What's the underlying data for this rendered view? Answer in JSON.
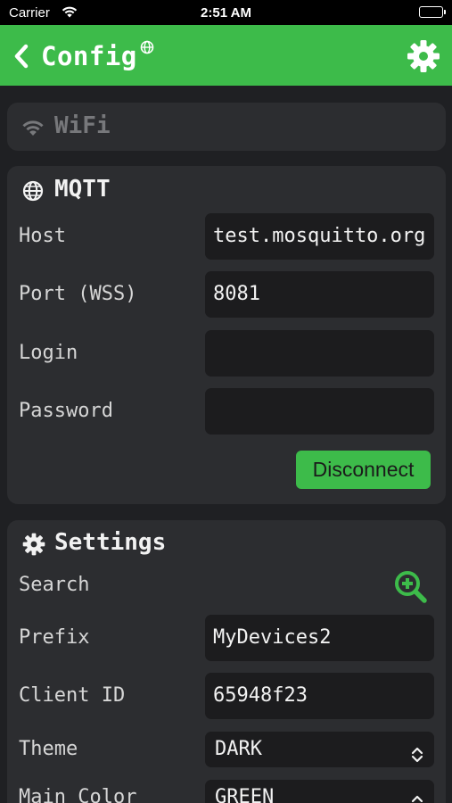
{
  "status_bar": {
    "carrier": "Carrier",
    "time": "2:51 AM"
  },
  "header": {
    "title": "Config"
  },
  "wifi": {
    "label": "WiFi"
  },
  "mqtt": {
    "title": "MQTT",
    "fields": [
      {
        "label": "Host",
        "value": "test.mosquitto.org"
      },
      {
        "label": "Port (WSS)",
        "value": "8081"
      },
      {
        "label": "Login",
        "value": ""
      },
      {
        "label": "Password",
        "value": ""
      }
    ],
    "disconnect_label": "Disconnect"
  },
  "settings": {
    "title": "Settings",
    "search_label": "Search",
    "prefix": {
      "label": "Prefix",
      "value": "MyDevices2"
    },
    "client_id": {
      "label": "Client ID",
      "value": "65948f23"
    },
    "theme": {
      "label": "Theme",
      "value": "DARK"
    },
    "main_color": {
      "label": "Main Color",
      "value": "GREEN"
    }
  },
  "colors": {
    "accent": "#3dbb4a",
    "background": "#1f2023",
    "card": "#2c2d30",
    "field": "#1c1c1e"
  },
  "icons": [
    "wifi-icon",
    "back-chevron-icon",
    "globe-icon",
    "gear-icon",
    "zoom-in-icon",
    "select-chevron-icon"
  ]
}
